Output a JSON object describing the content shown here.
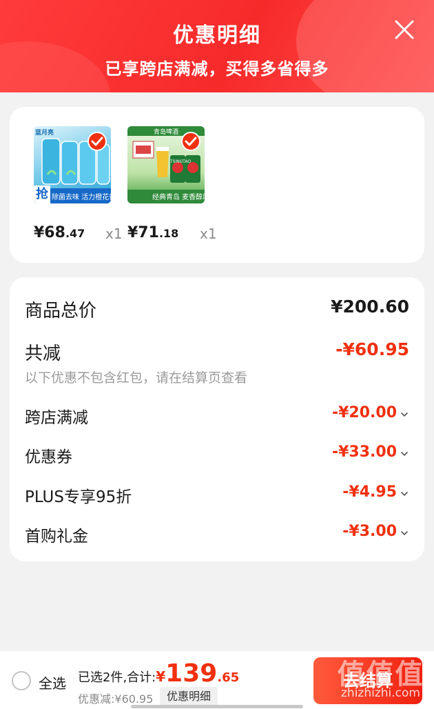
{
  "header": {
    "title": "优惠明细",
    "subtitle": "已享跨店满减，买得多省得多"
  },
  "products": [
    {
      "brand_text": "蓝月亮",
      "badge_text": "抢",
      "banner_text": "除菌去味 活力橙花香",
      "price_int": "¥68",
      "price_dec": ".47",
      "qty": "x1"
    },
    {
      "brand_text": "青岛啤酒",
      "can_text": "TSINGTAO",
      "banner_text": "经典青岛 麦香醇厚",
      "price_int": "¥71",
      "price_dec": ".18",
      "qty": "x1"
    }
  ],
  "summary": {
    "total_label": "商品总价",
    "total_value": "¥200.60",
    "reduce_label": "共减",
    "reduce_value": "-¥60.95",
    "hint": "以下优惠不包含红包，请在结算页查看",
    "items": [
      {
        "label": "跨店满减",
        "value": "-¥20.00"
      },
      {
        "label": "优惠券",
        "value": "-¥33.00"
      },
      {
        "label": "PLUS专享95折",
        "value": "-¥4.95"
      },
      {
        "label": "首购礼金",
        "value": "-¥3.00"
      }
    ]
  },
  "bottom_bar": {
    "select_all": "全选",
    "selected_text": "已选2件,合计:",
    "currency": "¥",
    "total_int": "139",
    "total_dec": ".65",
    "discount_text": "优惠减:¥60.95",
    "detail_button": "优惠明细",
    "checkout_button": "去结算"
  },
  "watermark": {
    "logo": "值值值",
    "text": "zhizhizhi.com"
  },
  "colors": {
    "header_red": "#f72a2a",
    "price_red": "#f0300f",
    "background": "#f2f2f2"
  }
}
